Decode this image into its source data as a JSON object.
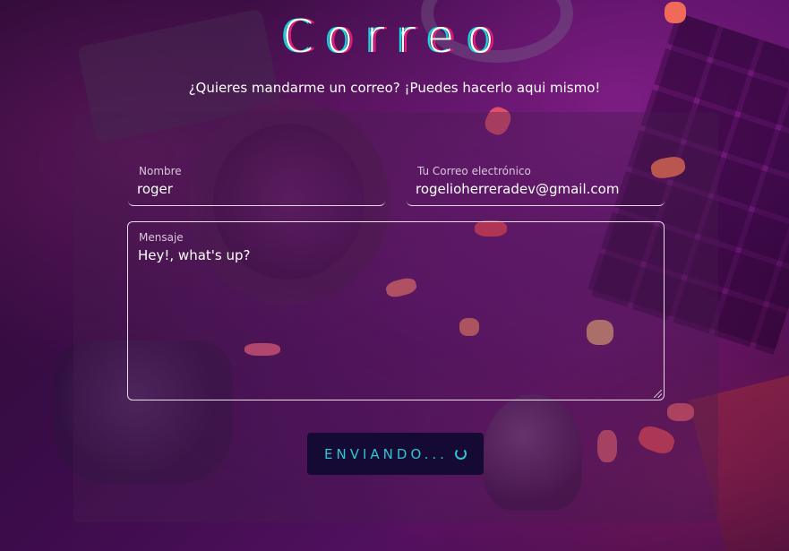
{
  "header": {
    "title": "Correo",
    "subtitle": "¿Quieres mandarme un correo? ¡Puedes hacerlo aqui mismo!"
  },
  "form": {
    "name": {
      "label": "Nombre",
      "value": "roger"
    },
    "email": {
      "label": "Tu Correo electrónico",
      "value": "rogelioherreradev@gmail.com"
    },
    "message": {
      "label": "Mensaje",
      "value": "Hey!, what's up?"
    },
    "submit": {
      "label": "ENVIANDO...",
      "icon": "loading-spinner-icon"
    }
  },
  "colors": {
    "accent_cyan": "#2bc6d6",
    "accent_pink": "#e81a78",
    "button_bg": "#140a33"
  }
}
